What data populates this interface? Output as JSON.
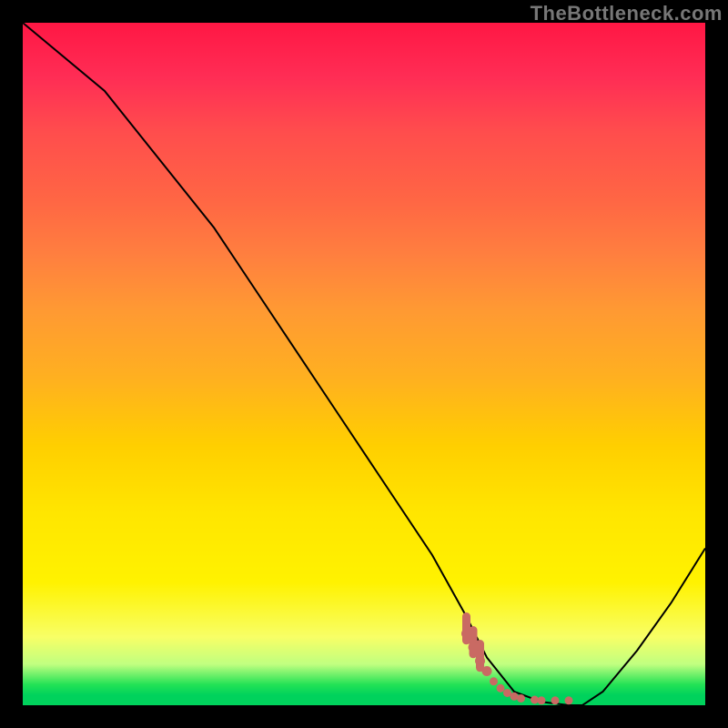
{
  "watermark": "TheBottleneck.com",
  "chart_data": {
    "type": "line",
    "title": "",
    "xlabel": "",
    "ylabel": "",
    "xlim": [
      0,
      100
    ],
    "ylim": [
      0,
      100
    ],
    "series": [
      {
        "name": "bottleneck-curve",
        "x": [
          0,
          12,
          20,
          28,
          36,
          44,
          52,
          60,
          65,
          68,
          72,
          76,
          80,
          82,
          85,
          90,
          95,
          100
        ],
        "values": [
          100,
          90,
          80,
          70,
          58,
          46,
          34,
          22,
          13,
          7,
          2,
          0.5,
          0,
          0,
          2,
          8,
          15,
          23
        ]
      }
    ],
    "markers": {
      "name": "optimal-range-markers",
      "x": [
        65,
        66,
        67,
        68,
        69,
        70,
        71,
        72,
        73,
        75,
        76,
        78,
        80
      ],
      "values": [
        10.5,
        8.5,
        6.5,
        5.0,
        3.5,
        2.5,
        1.8,
        1.3,
        1.0,
        0.8,
        0.7,
        0.7,
        0.7
      ]
    },
    "grid": false,
    "legend": false
  }
}
